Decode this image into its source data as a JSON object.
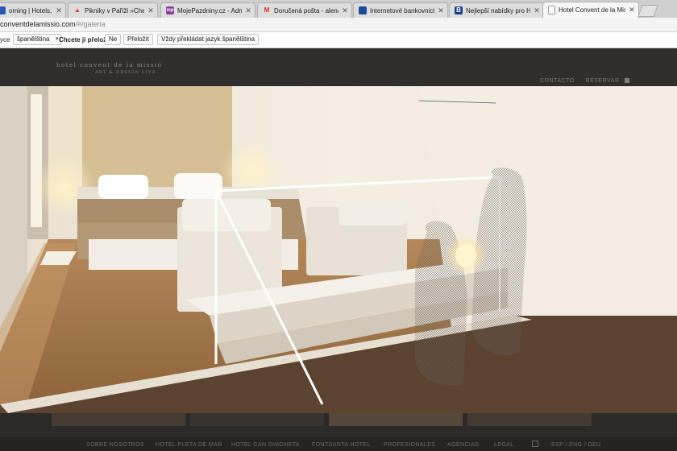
{
  "browser": {
    "tabs": [
      {
        "title": "oming | Hotels, Transfe",
        "favicon": "booking-icon",
        "color": "#2a5ab7",
        "active": false
      },
      {
        "title": "Pikniky v Paříži »Chef Justin K",
        "favicon": "warning-triangle-icon",
        "color": "#d9342b",
        "active": false
      },
      {
        "title": "MojePazdniny.cz - Administrac",
        "favicon": "mp-icon",
        "color": "#8a3c9c",
        "active": false
      },
      {
        "title": "Doručená pošta - alena@apc",
        "favicon": "gmail-icon",
        "color": "#d93025",
        "active": false
      },
      {
        "title": "Internetové bankovnictví",
        "favicon": "bank-icon",
        "color": "#1c4e9c",
        "active": false
      },
      {
        "title": "Nejlepší nabídky pro Hotel Co",
        "favicon": "b-icon",
        "color": "#1a3e8c",
        "active": false
      },
      {
        "title": "Hotel Convent de la Missió",
        "favicon": "page-icon",
        "color": "#999999",
        "active": true
      }
    ],
    "address": {
      "host": "conventdelamissio.com",
      "path": "/#/galeria"
    },
    "translate_bar": {
      "lang_label": "yce",
      "lang_value": "španělština",
      "question": "Chcete ji přeložit?",
      "no_label": "Ne",
      "translate_label": "Přeložit",
      "always_label": "Vždy překládat jazyk španělština"
    }
  },
  "site": {
    "logo": {
      "name": "hotel convent de la missió",
      "tagline": "ART & DESIGN LIVE"
    },
    "nav": {
      "contact": "CONTACTO",
      "reserve": "RESERVAR"
    },
    "footer_nav": [
      "SOBRE NOSOTROS",
      "HOTEL PLETA DE MAR",
      "HOTEL CAN SIMONETA",
      "FONTSANTA HOTEL",
      "PROFESIONALES",
      "AGENCIAS",
      "LEGAL",
      "ESP / ENG / DEU"
    ],
    "colors": {
      "header_bg": "#2f2e2c",
      "accent_text": "#7e7c78"
    }
  }
}
